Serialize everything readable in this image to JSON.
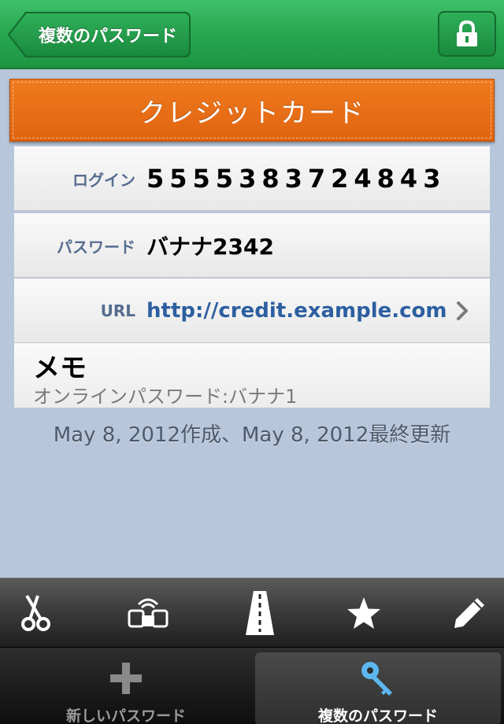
{
  "navbar": {
    "back_label": "複数のパスワード",
    "lock_icon": "lock-icon"
  },
  "banner": {
    "title": "クレジットカード"
  },
  "fields": {
    "login_label": "ログイン",
    "login_value": "5555383724843",
    "password_label": "パスワード",
    "password_value": "バナナ2342",
    "url_label": "URL",
    "url_value": "http://credit.example.com"
  },
  "memo": {
    "title": "メモ",
    "text": "オンラインパスワード:バナナ1"
  },
  "footer_note": "May 8, 2012作成、May 8, 2012最終更新",
  "toolbar": {
    "icons": [
      "scissors-icon",
      "share-icon",
      "road-icon",
      "star-icon",
      "pencil-icon"
    ]
  },
  "tabbar": {
    "new_label": "新しいパスワード",
    "multi_label": "複数のパスワード",
    "active_tab": "multi"
  },
  "colors": {
    "nav_green": "#26a64f",
    "banner_orange": "#e86c14",
    "background": "#b8c6db",
    "url_blue": "#2c5fa0"
  }
}
